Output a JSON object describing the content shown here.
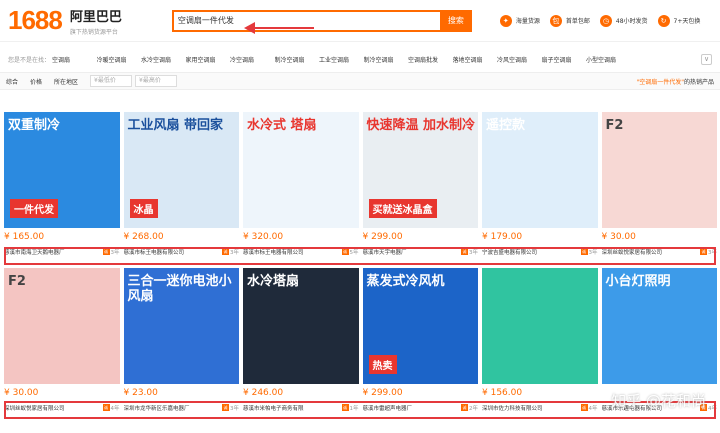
{
  "header": {
    "logo_number": "1688",
    "logo_name": "阿里巴巴",
    "logo_sub": "旗下热销货源平台",
    "search_value": "空调扇一件代发",
    "search_button": "搜索",
    "services": [
      {
        "icon": "hot-icon",
        "label": "海量货源"
      },
      {
        "icon": "freeship-icon",
        "label": "首单包邮"
      },
      {
        "icon": "clock-icon",
        "label": "48小时发货"
      },
      {
        "icon": "return-icon",
        "label": "7+天包换"
      }
    ]
  },
  "categories": {
    "label": "您是不是在找：",
    "items": [
      "空调扇",
      "冷暖空调扇",
      "水冷空调扇",
      "家用空调扇",
      "冷空调扇",
      "制冷空调扇",
      "工业空调扇",
      "制冷空调扇",
      "空调扇批发",
      "落地空调扇",
      "冷风空调扇",
      "扇子空调扇",
      "小型空调扇"
    ],
    "more": "∨"
  },
  "filters": {
    "items": [
      "综合",
      "价格",
      "所在地区"
    ],
    "price_min_placeholder": "¥最低价",
    "price_max_placeholder": "¥最高价",
    "hot_prefix": "\"空调扇一件代发\"",
    "hot_suffix": "的热销产品"
  },
  "products_row1": [
    {
      "price": "¥ 165.00",
      "seller": "慈溪市南海卫天鹅电器厂",
      "years": "3年",
      "img_text": "双重制冷",
      "badge": "一件代发",
      "bg": "#2b8ae0",
      "fg": "#ffffff"
    },
    {
      "price": "¥ 268.00",
      "seller": "慈溪市标王电器有限公司",
      "years": "3年",
      "img_text": "工业风扇 带回家",
      "badge": "冰晶",
      "bg": "#d9e8f5",
      "fg": "#1a4f9c"
    },
    {
      "price": "¥ 320.00",
      "seller": "慈溪市标王电器有限公司",
      "years": "5年",
      "img_text": "水冷式 塔扇",
      "badge": "",
      "bg": "#eef5fb",
      "fg": "#e8362f"
    },
    {
      "price": "¥ 299.00",
      "seller": "慈溪市天宇电器厂",
      "years": "3年",
      "img_text": "快速降温 加水制冷",
      "badge": "买就送冰晶盒",
      "bg": "#e9eef2",
      "fg": "#e8362f"
    },
    {
      "price": "¥ 179.00",
      "seller": "宁波吉盛电器有限公司",
      "years": "3年",
      "img_text": "遥控款",
      "badge": "",
      "bg": "#dfeefa",
      "fg": "#ffffff"
    },
    {
      "price": "¥ 30.00",
      "seller": "深圳丝蚁悦家居有限公司",
      "years": "3年",
      "img_text": "F2",
      "badge": "",
      "bg": "#f7d8d4",
      "fg": "#444444"
    }
  ],
  "products_row2": [
    {
      "price": "¥ 30.00",
      "seller": "深圳丝蚁悦家居有限公司",
      "years": "4年",
      "img_text": "F2",
      "badge": "",
      "bg": "#f4c5c2",
      "fg": "#444444"
    },
    {
      "price": "¥ 23.00",
      "seller": "深圳市龙华新区乐嘉电器厂",
      "years": "3年",
      "img_text": "三合一迷你电池小风扇",
      "badge": "",
      "bg": "#2f6fd4",
      "fg": "#ffffff"
    },
    {
      "price": "¥ 246.00",
      "seller": "慈溪市米帕电子商务有限",
      "years": "1年",
      "img_text": "水冷塔扇",
      "badge": "",
      "bg": "#1f2a3a",
      "fg": "#ffffff"
    },
    {
      "price": "¥ 299.00",
      "seller": "慈溪市雷超声电器厂",
      "years": "2年",
      "img_text": "蒸发式冷风机",
      "badge": "热卖",
      "bg": "#1c64c8",
      "fg": "#ffffff"
    },
    {
      "price": "¥ 156.00",
      "seller": "深圳市佐力科技有限公司",
      "years": "4年",
      "img_text": "",
      "badge": "",
      "bg": "#30c4a0",
      "fg": "#ffffff"
    },
    {
      "price": "",
      "seller": "慈溪市乐趣电器有限公司",
      "years": "4年",
      "img_text": "小台灯照明",
      "badge": "",
      "bg": "#3d9be9",
      "fg": "#ffffff"
    }
  ],
  "watermark": "知乎 @花和尚"
}
